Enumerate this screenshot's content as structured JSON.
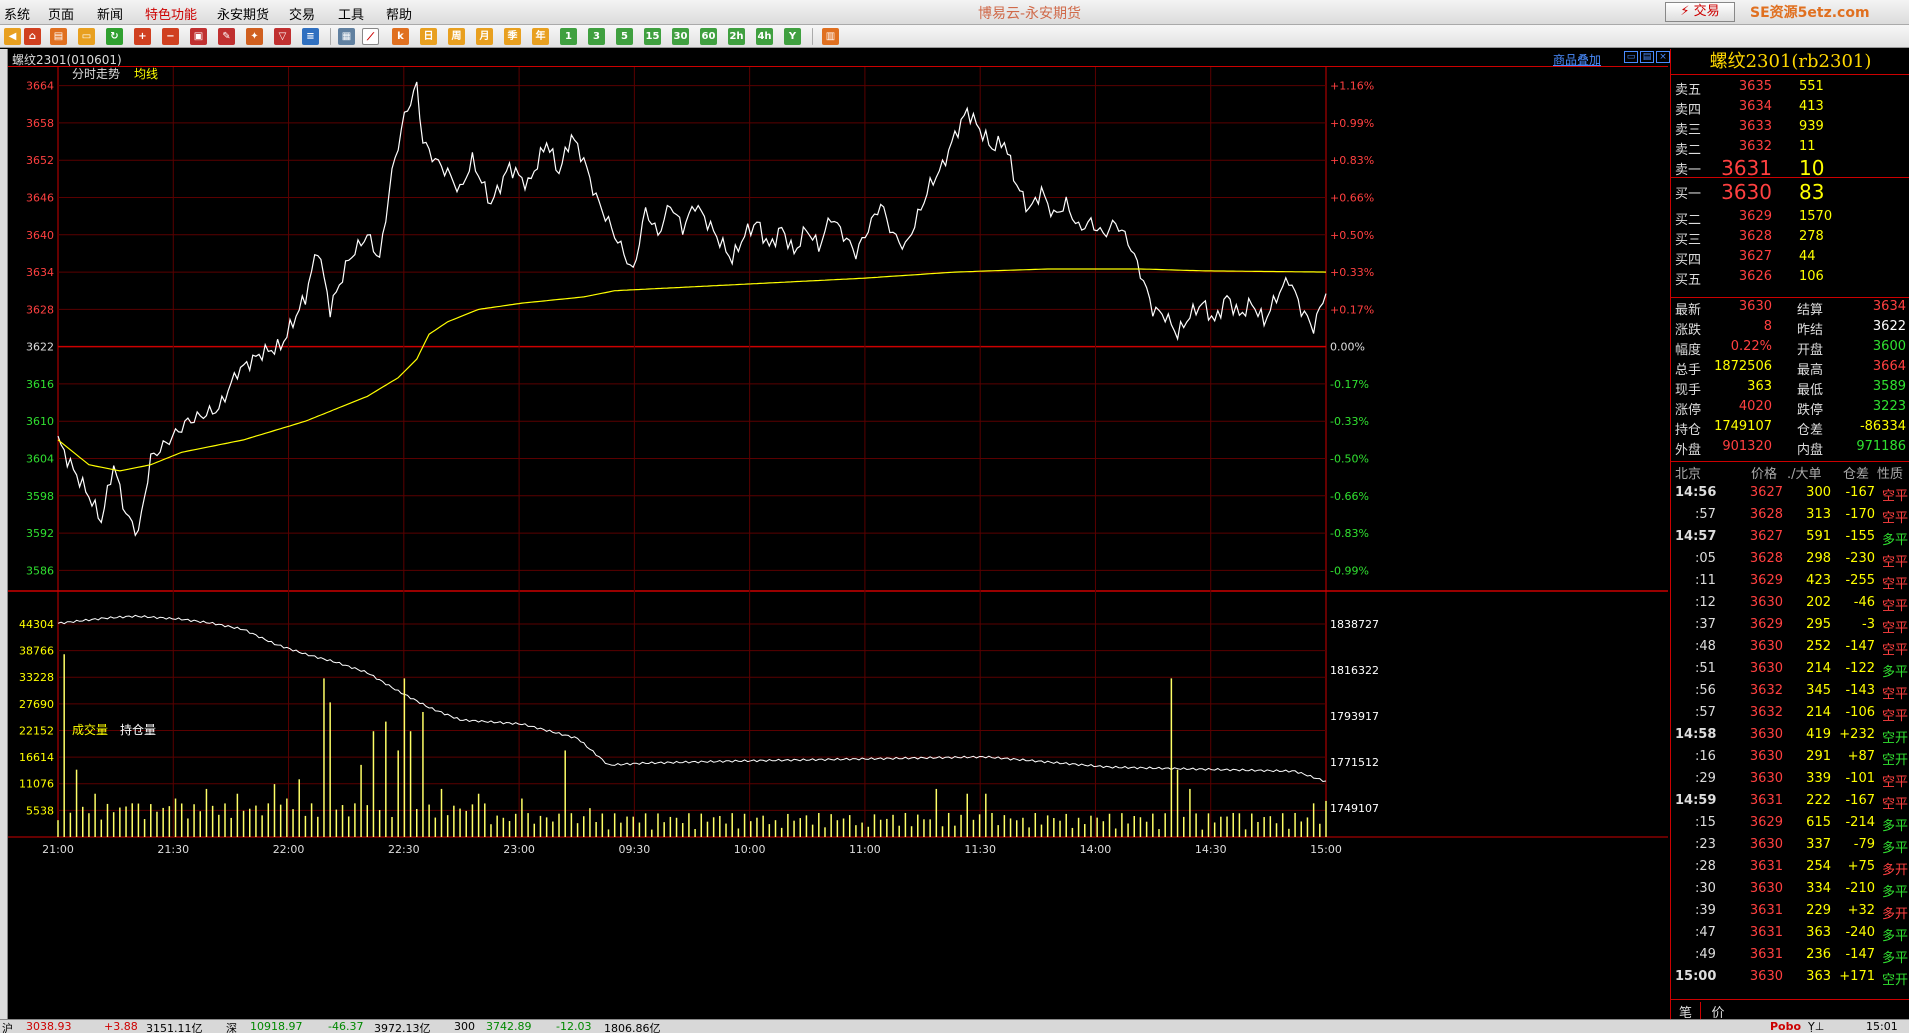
{
  "app": {
    "title": "博易云-永安期货",
    "trade_button": "⚡ 交易",
    "watermark": "SE资源5etz.com"
  },
  "menu": [
    "系统",
    "页面",
    "新闻",
    "特色功能",
    "永安期货",
    "交易",
    "工具",
    "帮助"
  ],
  "menu_active": "特色功能",
  "toolbar": {
    "text_buttons": [
      "日",
      "周",
      "月",
      "季",
      "年",
      "1",
      "3",
      "5",
      "15",
      "30",
      "60",
      "2h",
      "4h",
      "Y"
    ]
  },
  "chart_header": {
    "title": "螺纹2301(010601)",
    "overlay_link": "商品叠加",
    "price_panel_label": "分时走势",
    "avg_label": "均线",
    "volume_label": "成交量",
    "oi_label": "持仓量"
  },
  "chart_data": {
    "type": "line",
    "prev_settle": 3622,
    "price_axis": {
      "ticks": [
        3664,
        3658,
        3652,
        3646,
        3640,
        3634,
        3628,
        3622,
        3616,
        3610,
        3604,
        3598,
        3592,
        3586
      ],
      "pct_ticks": [
        "+1.16%",
        "+0.99%",
        "+0.83%",
        "+0.66%",
        "+0.50%",
        "+0.33%",
        "+0.17%",
        "0.00%",
        "-0.17%",
        "-0.33%",
        "-0.50%",
        "-0.66%",
        "-0.83%",
        "-0.99%"
      ],
      "ylim": [
        3583,
        3667
      ]
    },
    "volume_axis": {
      "ticks": [
        44304,
        38766,
        33228,
        27690,
        22152,
        16614,
        11076,
        5538
      ],
      "ylim": [
        0,
        47000
      ]
    },
    "oi_axis": {
      "ticks": [
        1838727,
        1816322,
        1793917,
        1771512,
        1749107
      ],
      "ylim": [
        1735000,
        1845000
      ]
    },
    "x_labels": [
      "21:00",
      "21:30",
      "22:00",
      "22:30",
      "23:00",
      "09:30",
      "10:00",
      "11:00",
      "11:30",
      "14:00",
      "14:30",
      "15:00"
    ],
    "n_points": 345,
    "price_keypoints": [
      [
        0,
        3607
      ],
      [
        4,
        3603
      ],
      [
        10,
        3598
      ],
      [
        14,
        3594
      ],
      [
        18,
        3603
      ],
      [
        22,
        3595
      ],
      [
        26,
        3592
      ],
      [
        30,
        3604
      ],
      [
        36,
        3607
      ],
      [
        42,
        3610
      ],
      [
        52,
        3612
      ],
      [
        58,
        3618
      ],
      [
        66,
        3621
      ],
      [
        72,
        3622
      ],
      [
        76,
        3626
      ],
      [
        80,
        3630
      ],
      [
        84,
        3638
      ],
      [
        88,
        3628
      ],
      [
        94,
        3636
      ],
      [
        100,
        3640
      ],
      [
        104,
        3636
      ],
      [
        108,
        3650
      ],
      [
        112,
        3659
      ],
      [
        116,
        3664
      ],
      [
        118,
        3655
      ],
      [
        122,
        3652
      ],
      [
        126,
        3650
      ],
      [
        130,
        3647
      ],
      [
        134,
        3652
      ],
      [
        140,
        3645
      ],
      [
        146,
        3651
      ],
      [
        152,
        3648
      ],
      [
        158,
        3655
      ],
      [
        162,
        3650
      ],
      [
        166,
        3656
      ],
      [
        170,
        3652
      ],
      [
        174,
        3646
      ],
      [
        178,
        3642
      ],
      [
        182,
        3638
      ],
      [
        186,
        3634
      ],
      [
        190,
        3644
      ],
      [
        194,
        3640
      ],
      [
        198,
        3645
      ],
      [
        202,
        3641
      ],
      [
        206,
        3645
      ],
      [
        210,
        3642
      ],
      [
        214,
        3639
      ],
      [
        218,
        3636
      ],
      [
        222,
        3640
      ],
      [
        226,
        3642
      ],
      [
        230,
        3638
      ],
      [
        234,
        3641
      ],
      [
        238,
        3637
      ],
      [
        242,
        3641
      ],
      [
        246,
        3638
      ],
      [
        250,
        3643
      ],
      [
        254,
        3640
      ],
      [
        258,
        3637
      ],
      [
        262,
        3641
      ],
      [
        266,
        3645
      ],
      [
        270,
        3640
      ],
      [
        274,
        3638
      ],
      [
        278,
        3643
      ],
      [
        282,
        3648
      ],
      [
        286,
        3651
      ],
      [
        290,
        3656
      ],
      [
        294,
        3660
      ],
      [
        298,
        3657
      ],
      [
        302,
        3654
      ],
      [
        306,
        3655
      ],
      [
        310,
        3648
      ],
      [
        314,
        3644
      ],
      [
        318,
        3647
      ],
      [
        322,
        3643
      ],
      [
        326,
        3645
      ],
      [
        330,
        3641
      ],
      [
        334,
        3642
      ],
      [
        338,
        3640
      ],
      [
        342,
        3642
      ],
      [
        346,
        3639
      ],
      [
        350,
        3634
      ],
      [
        354,
        3628
      ],
      [
        358,
        3627
      ],
      [
        362,
        3624
      ],
      [
        366,
        3627
      ],
      [
        370,
        3629
      ],
      [
        374,
        3626
      ],
      [
        378,
        3630
      ],
      [
        382,
        3627
      ],
      [
        386,
        3629
      ],
      [
        390,
        3626
      ],
      [
        394,
        3630
      ],
      [
        398,
        3633
      ],
      [
        402,
        3628
      ],
      [
        406,
        3625
      ],
      [
        410,
        3631
      ]
    ],
    "avg_keypoints": [
      [
        0,
        3607
      ],
      [
        10,
        3603
      ],
      [
        20,
        3602
      ],
      [
        30,
        3603
      ],
      [
        40,
        3605
      ],
      [
        60,
        3607
      ],
      [
        80,
        3610
      ],
      [
        100,
        3614
      ],
      [
        110,
        3617
      ],
      [
        116,
        3620
      ],
      [
        120,
        3624
      ],
      [
        126,
        3626
      ],
      [
        136,
        3628
      ],
      [
        150,
        3629
      ],
      [
        170,
        3630
      ],
      [
        180,
        3631
      ],
      [
        220,
        3632
      ],
      [
        260,
        3633
      ],
      [
        290,
        3634
      ],
      [
        320,
        3634.5
      ],
      [
        350,
        3634.5
      ],
      [
        370,
        3634.2
      ],
      [
        410,
        3634
      ]
    ],
    "oi_keypoints": [
      [
        0,
        1839000
      ],
      [
        15,
        1841500
      ],
      [
        25,
        1842500
      ],
      [
        40,
        1841000
      ],
      [
        50,
        1839000
      ],
      [
        60,
        1836000
      ],
      [
        70,
        1829000
      ],
      [
        80,
        1824000
      ],
      [
        90,
        1820000
      ],
      [
        100,
        1815000
      ],
      [
        110,
        1806000
      ],
      [
        120,
        1798000
      ],
      [
        130,
        1792000
      ],
      [
        150,
        1790000
      ],
      [
        168,
        1783000
      ],
      [
        178,
        1770000
      ],
      [
        190,
        1771000
      ],
      [
        220,
        1772000
      ],
      [
        260,
        1773000
      ],
      [
        300,
        1774000
      ],
      [
        340,
        1769000
      ],
      [
        370,
        1768000
      ],
      [
        400,
        1767000
      ],
      [
        410,
        1762000
      ]
    ],
    "volume_spikes": [
      [
        2,
        38000
      ],
      [
        6,
        14000
      ],
      [
        12,
        9000
      ],
      [
        24,
        7000
      ],
      [
        38,
        8000
      ],
      [
        48,
        10000
      ],
      [
        58,
        9000
      ],
      [
        70,
        11000
      ],
      [
        74,
        8000
      ],
      [
        79,
        12000
      ],
      [
        86,
        33000
      ],
      [
        88,
        28000
      ],
      [
        98,
        15000
      ],
      [
        103,
        22000
      ],
      [
        106,
        24000
      ],
      [
        110,
        18000
      ],
      [
        112,
        33000
      ],
      [
        114,
        22000
      ],
      [
        118,
        26000
      ],
      [
        124,
        10000
      ],
      [
        136,
        9000
      ],
      [
        150,
        8000
      ],
      [
        165,
        18000
      ],
      [
        172,
        6000
      ],
      [
        200,
        4000
      ],
      [
        232,
        3500
      ],
      [
        260,
        3000
      ],
      [
        284,
        10000
      ],
      [
        294,
        9000
      ],
      [
        300,
        9000
      ],
      [
        312,
        4000
      ],
      [
        330,
        4000
      ],
      [
        360,
        33000
      ],
      [
        362,
        14000
      ],
      [
        366,
        10000
      ],
      [
        380,
        5000
      ],
      [
        400,
        5000
      ],
      [
        406,
        7000
      ],
      [
        410,
        7500
      ]
    ]
  },
  "instrument": {
    "title": "螺纹2301(rb2301)",
    "asks": [
      {
        "label": "卖五",
        "price": "3635",
        "vol": "551"
      },
      {
        "label": "卖四",
        "price": "3634",
        "vol": "413"
      },
      {
        "label": "卖三",
        "price": "3633",
        "vol": "939"
      },
      {
        "label": "卖二",
        "price": "3632",
        "vol": "11"
      },
      {
        "label": "卖一",
        "price": "3631",
        "vol": "10"
      }
    ],
    "bids": [
      {
        "label": "买一",
        "price": "3630",
        "vol": "83"
      },
      {
        "label": "买二",
        "price": "3629",
        "vol": "1570"
      },
      {
        "label": "买三",
        "price": "3628",
        "vol": "278"
      },
      {
        "label": "买四",
        "price": "3627",
        "vol": "44"
      },
      {
        "label": "买五",
        "price": "3626",
        "vol": "106"
      }
    ],
    "quotes": [
      {
        "l1": "最新",
        "v1": "3630",
        "c1": "#ff4040",
        "l2": "结算",
        "v2": "3634",
        "c2": "#ff4040"
      },
      {
        "l1": "涨跌",
        "v1": "8",
        "c1": "#ff4040",
        "l2": "昨结",
        "v2": "3622",
        "c2": "#ffffff"
      },
      {
        "l1": "幅度",
        "v1": "0.22%",
        "c1": "#ff4040",
        "l2": "开盘",
        "v2": "3600",
        "c2": "#30e030"
      },
      {
        "l1": "总手",
        "v1": "1872506",
        "c1": "#ffff00",
        "l2": "最高",
        "v2": "3664",
        "c2": "#ff4040"
      },
      {
        "l1": "现手",
        "v1": "363",
        "c1": "#ffff00",
        "l2": "最低",
        "v2": "3589",
        "c2": "#30e030"
      },
      {
        "l1": "涨停",
        "v1": "4020",
        "c1": "#ff4040",
        "l2": "跌停",
        "v2": "3223",
        "c2": "#30e030"
      },
      {
        "l1": "持仓",
        "v1": "1749107",
        "c1": "#ffff00",
        "l2": "仓差",
        "v2": "-86334",
        "c2": "#ffff00"
      },
      {
        "l1": "外盘",
        "v1": "901320",
        "c1": "#ff4040",
        "l2": "内盘",
        "v2": "971186",
        "c2": "#30e030"
      }
    ]
  },
  "ticks_header": {
    "time": "北京",
    "price": "价格",
    "vol": "./大单",
    "oi": "仓差",
    "kind": "性质"
  },
  "ticks": [
    {
      "t": "14:56",
      "p": "3627",
      "v": "300",
      "d": "-167",
      "k": "空平",
      "min": true
    },
    {
      "t": ":57",
      "p": "3628",
      "v": "313",
      "d": "-170",
      "k": "空平"
    },
    {
      "t": "14:57",
      "p": "3627",
      "v": "591",
      "d": "-155",
      "k": "多平",
      "min": true
    },
    {
      "t": ":05",
      "p": "3628",
      "v": "298",
      "d": "-230",
      "k": "空平"
    },
    {
      "t": ":11",
      "p": "3629",
      "v": "423",
      "d": "-255",
      "k": "空平"
    },
    {
      "t": ":12",
      "p": "3630",
      "v": "202",
      "d": "-46",
      "k": "空平"
    },
    {
      "t": ":37",
      "p": "3629",
      "v": "295",
      "d": "-3",
      "k": "空平"
    },
    {
      "t": ":48",
      "p": "3630",
      "v": "252",
      "d": "-147",
      "k": "空平"
    },
    {
      "t": ":51",
      "p": "3630",
      "v": "214",
      "d": "-122",
      "k": "多平"
    },
    {
      "t": ":56",
      "p": "3632",
      "v": "345",
      "d": "-143",
      "k": "空平"
    },
    {
      "t": ":57",
      "p": "3632",
      "v": "214",
      "d": "-106",
      "k": "空平"
    },
    {
      "t": "14:58",
      "p": "3630",
      "v": "419",
      "d": "+232",
      "k": "空开",
      "min": true
    },
    {
      "t": ":16",
      "p": "3630",
      "v": "291",
      "d": "+87",
      "k": "空开"
    },
    {
      "t": ":29",
      "p": "3630",
      "v": "339",
      "d": "-101",
      "k": "空平"
    },
    {
      "t": "14:59",
      "p": "3631",
      "p_c": "",
      "v": "222",
      "d": "-167",
      "k": "空平",
      "min": true
    },
    {
      "t": ":15",
      "p": "3629",
      "v": "615",
      "d": "-214",
      "k": "多平"
    },
    {
      "t": ":23",
      "p": "3630",
      "v": "337",
      "d": "-79",
      "k": "多平"
    },
    {
      "t": ":28",
      "p": "3631",
      "v": "254",
      "d": "+75",
      "k": "多开"
    },
    {
      "t": ":30",
      "p": "3630",
      "v": "334",
      "d": "-210",
      "k": "多平"
    },
    {
      "t": ":39",
      "p": "3631",
      "v": "229",
      "d": "+32",
      "k": "多开"
    },
    {
      "t": ":47",
      "p": "3631",
      "v": "363",
      "d": "-240",
      "k": "多平"
    },
    {
      "t": ":49",
      "p": "3631",
      "v": "236",
      "d": "-147",
      "k": "多平"
    },
    {
      "t": "15:00",
      "p": "3630",
      "v": "363",
      "d": "+171",
      "k": "空开",
      "min": true
    }
  ],
  "right_tabs": [
    "笔",
    "价"
  ],
  "statusbar": [
    "沪",
    "3038.93",
    "+3.88",
    "3151.11亿",
    "深",
    "10918.97",
    "-46.37",
    "3972.13亿",
    "300",
    "3742.89",
    "-12.03",
    "1806.86亿",
    "Pobo",
    "15:01"
  ]
}
